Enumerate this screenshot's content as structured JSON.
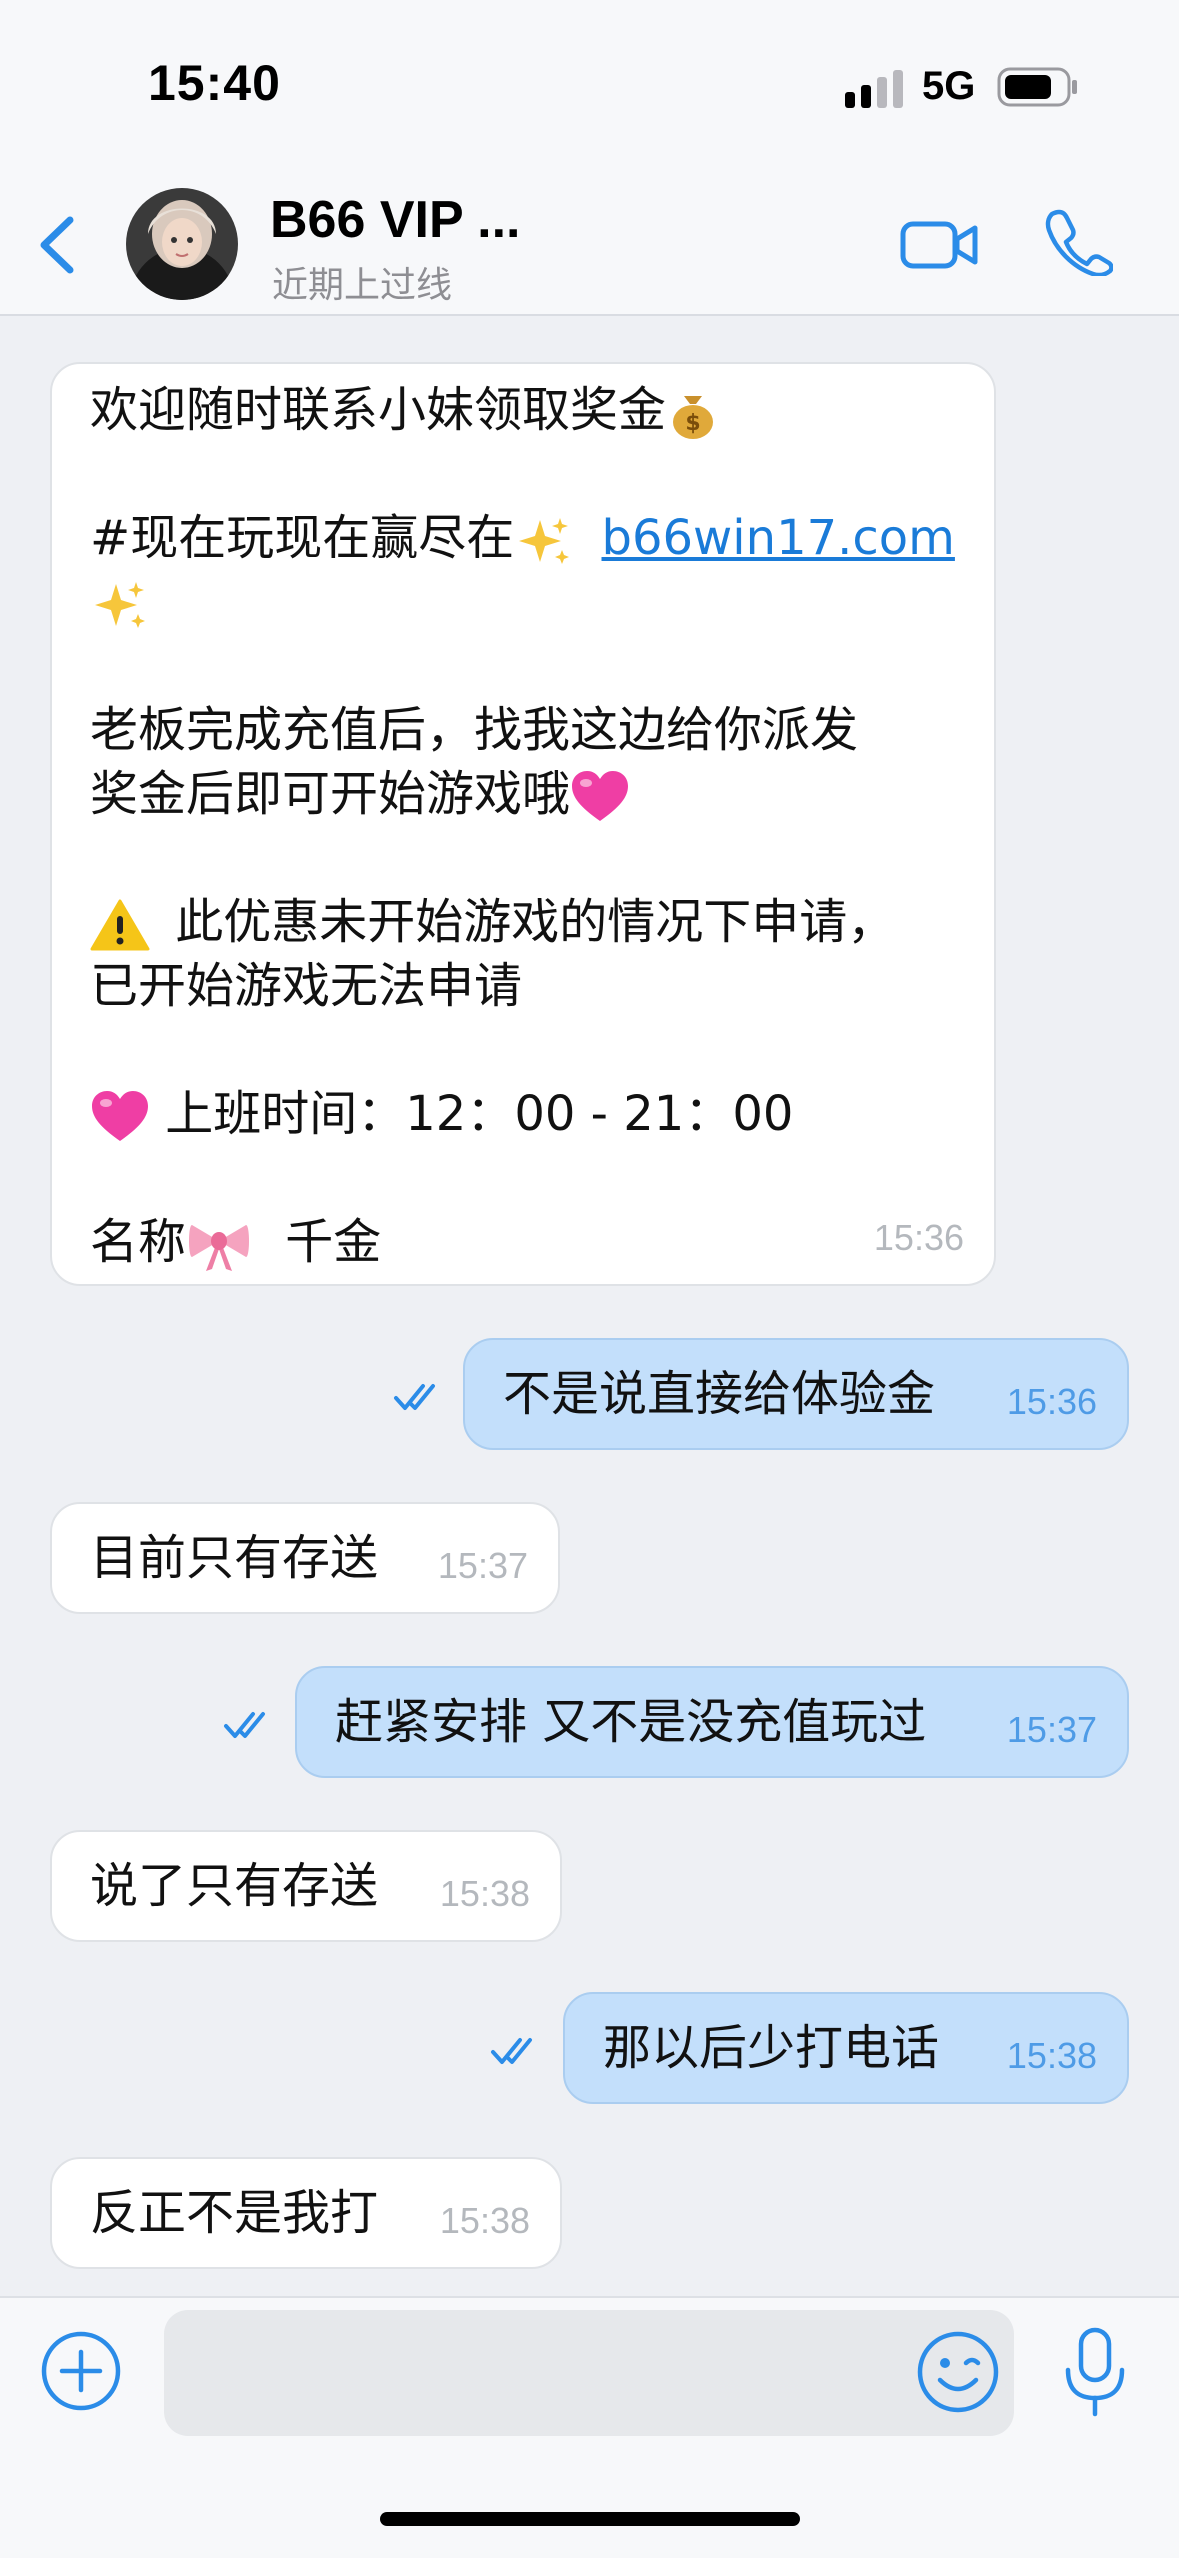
{
  "status_bar": {
    "time": "15:40",
    "network": "5G"
  },
  "header": {
    "title": "B66 VIP ...",
    "subtitle": "近期上过线"
  },
  "messages": [
    {
      "direction": "in",
      "lines": [
        "欢迎随时联系小妹领取奖金",
        "",
        "#现在玩现在赢尽在",
        "b66win17.com",
        "",
        "老板完成充值后，找我这边给你派发",
        "奖金后即可开始游戏哦",
        "",
        "此优惠未开始游戏的情况下申请，",
        "已开始游戏无法申请",
        "",
        "上班时间：12：00 - 21：00",
        "",
        "名称",
        "千金"
      ],
      "time": "15:36"
    },
    {
      "direction": "out",
      "text": "不是说直接给体验金",
      "time": "15:36"
    },
    {
      "direction": "in",
      "text": "目前只有存送",
      "time": "15:37"
    },
    {
      "direction": "out",
      "text": "赶紧安排 又不是没充值玩过",
      "time": "15:37"
    },
    {
      "direction": "in",
      "text": "说了只有存送",
      "time": "15:38"
    },
    {
      "direction": "out",
      "text": "那以后少打电话",
      "time": "15:38"
    },
    {
      "direction": "in",
      "text": "反正不是我打",
      "time": "15:38"
    }
  ],
  "input": {
    "placeholder": ""
  },
  "icons": {
    "back": "chevron-left-icon",
    "video": "video-camera-icon",
    "phone": "phone-icon",
    "attach": "plus-circle-icon",
    "emoji": "smiley-icon",
    "mic": "microphone-icon",
    "read": "double-check-icon"
  },
  "colors": {
    "accent": "#2b8ce8",
    "outgoing_bubble": "#c3dffb",
    "incoming_bubble": "#ffffff",
    "background": "#eef0f4"
  }
}
